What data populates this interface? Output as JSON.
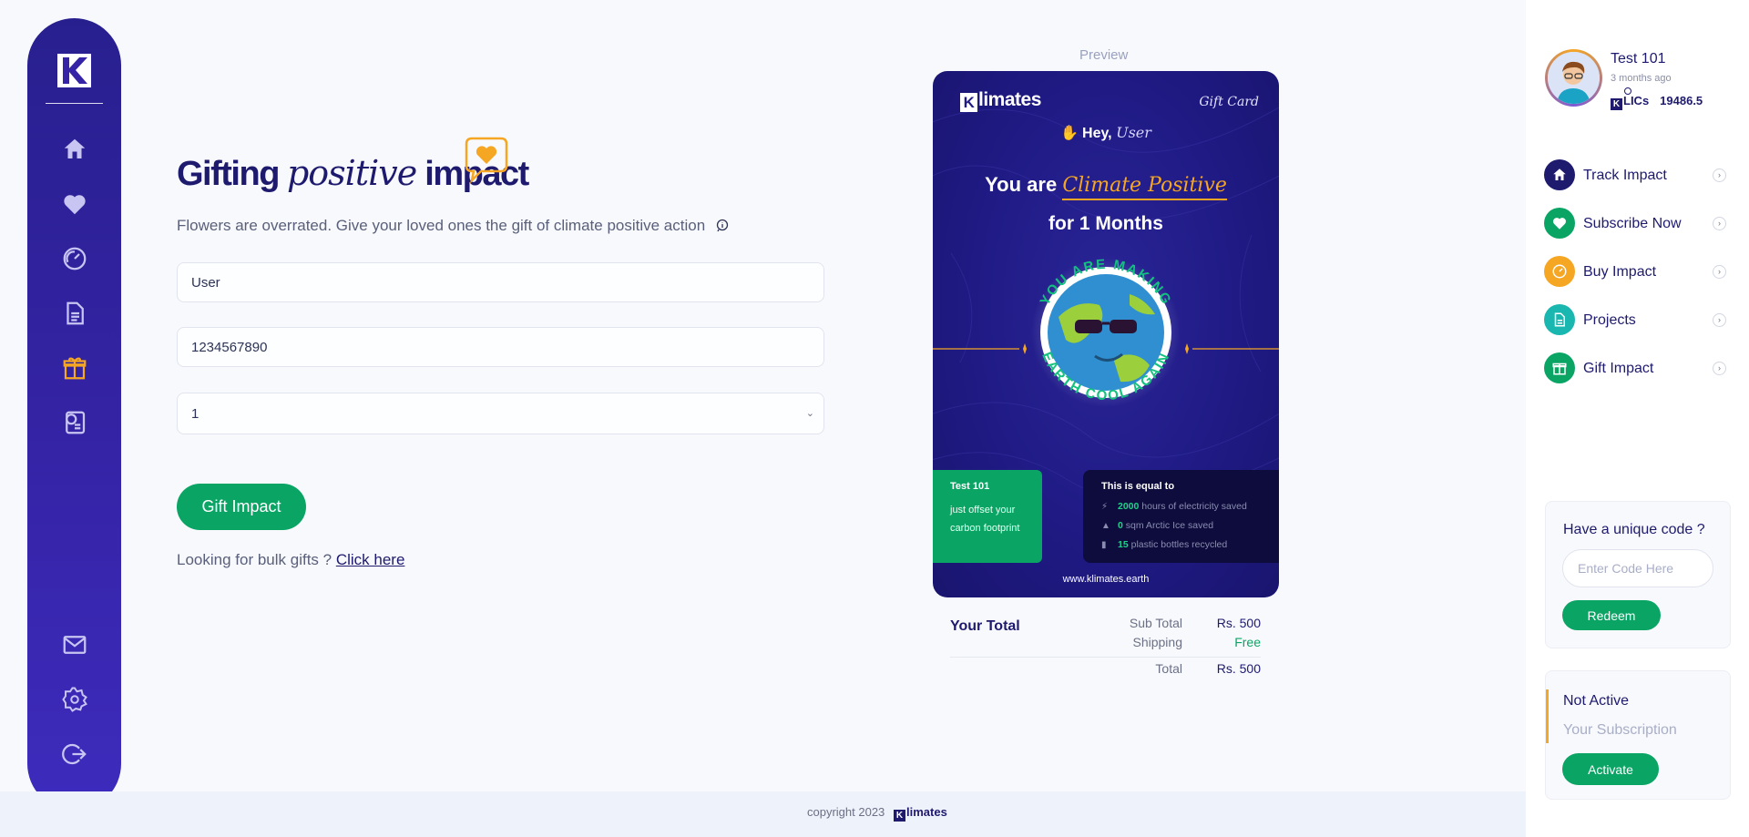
{
  "sidebar": {
    "logo_letter": "K",
    "icons": [
      "home-icon",
      "heart-icon",
      "speedometer-icon",
      "document-icon",
      "gift-icon",
      "currency-document-icon",
      "mail-icon",
      "settings-icon",
      "logout-icon"
    ],
    "active_color": "#f5a623"
  },
  "main": {
    "title_part1": "Gifting ",
    "title_script": "positive",
    "title_part2": " impact",
    "subtitle": "Flowers are overrated. Give your loved ones the gift of climate positive action",
    "name_value": "User",
    "phone_value": "1234567890",
    "months_value": "1",
    "gift_button": "Gift Impact",
    "bulk_text": "Looking for bulk gifts ? ",
    "bulk_link": "Click here"
  },
  "preview": {
    "label": "Preview",
    "brand": "limates",
    "brand_k": "K",
    "tag": "Gift Card",
    "hey": "Hey, ",
    "hey_user": "User",
    "line1_a": "You are ",
    "line1_b": "Climate Positive",
    "line2": "for 1 Months",
    "ring_top": "YOU ARE MAKING",
    "ring_bottom": "EARTH COOL AGAIN",
    "green_name": "Test 101",
    "green_line1": "just offset your",
    "green_line2": "carbon footprint",
    "equal_title": "This is equal to",
    "equal_rows": [
      {
        "num": "2000",
        "text": " hours of electricity saved",
        "icon": "plug-icon"
      },
      {
        "num": "0",
        "text": " sqm Arctic Ice saved",
        "icon": "iceberg-icon"
      },
      {
        "num": "15",
        "text": " plastic bottles recycled",
        "icon": "bottle-icon"
      }
    ],
    "url": "www.klimates.earth"
  },
  "totals": {
    "label": "Your Total",
    "subtotal_label": "Sub Total",
    "subtotal_value": "Rs. 500",
    "shipping_label": "Shipping",
    "shipping_value": "Free",
    "total_label": "Total",
    "total_value": "Rs. 500"
  },
  "user": {
    "name": "Test 101",
    "time": "3 months ago",
    "klics_label": "LICs",
    "klics_k": "K",
    "klics_value": "19486.5"
  },
  "nav": [
    {
      "label": "Track Impact",
      "color": "#1e1a6e",
      "icon": "home-icon"
    },
    {
      "label": "Subscribe Now",
      "color": "#0aa564",
      "icon": "heart-icon"
    },
    {
      "label": "Buy Impact",
      "color": "#f5a623",
      "icon": "speedometer-icon"
    },
    {
      "label": "Projects",
      "color": "#19b7b0",
      "icon": "document-icon"
    },
    {
      "label": "Gift Impact",
      "color": "#0aa564",
      "icon": "gift-icon"
    }
  ],
  "code": {
    "title": "Have a unique code ?",
    "placeholder": "Enter Code Here",
    "button": "Redeem"
  },
  "subscription": {
    "status": "Not Active",
    "label": "Your Subscription",
    "button": "Activate"
  },
  "footer": {
    "copyright": "copyright 2023",
    "brand": "limates",
    "brand_k": "K"
  },
  "colors": {
    "primary": "#1e1a6e",
    "sidebar": "#3524a6",
    "green": "#0aa564",
    "orange": "#f5a623"
  }
}
